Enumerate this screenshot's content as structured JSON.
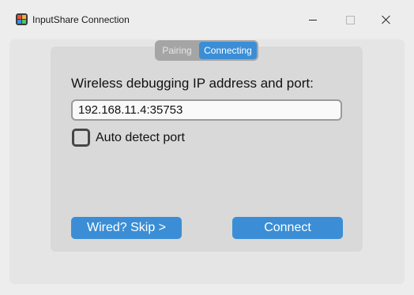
{
  "window": {
    "title": "InputShare Connection",
    "app_icon": "inputshare-app-icon",
    "controls": {
      "minimize_icon": "minimize-icon",
      "maximize_icon": "maximize-icon",
      "close_icon": "close-icon"
    }
  },
  "tabs": [
    {
      "label": "Pairing",
      "selected": false
    },
    {
      "label": "Connecting",
      "selected": true
    }
  ],
  "form": {
    "address_label": "Wireless debugging IP address and port:",
    "address_value": "192.168.11.4:35753",
    "auto_detect_label": "Auto detect port",
    "auto_detect_checked": false
  },
  "buttons": {
    "skip_label": "Wired? Skip >",
    "connect_label": "Connect"
  },
  "colors": {
    "accent": "#3b8ed5",
    "panel": "#d9d9d9",
    "segmented_bg": "#a5a5a5"
  }
}
